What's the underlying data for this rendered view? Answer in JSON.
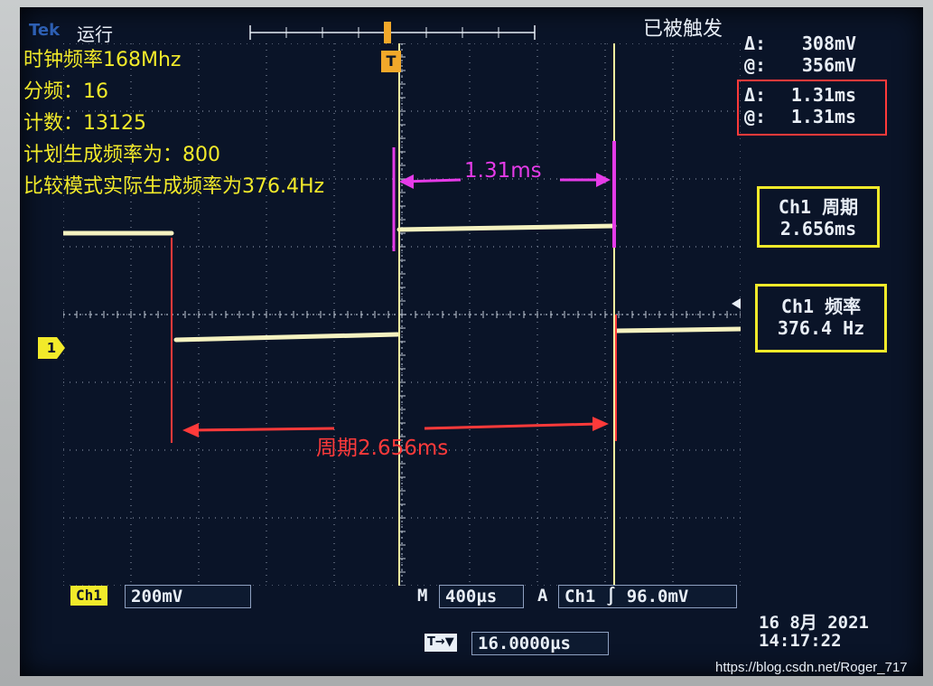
{
  "brand": "Tek",
  "run_state": "运行",
  "trigger_state": "已被触发",
  "overlay_notes": [
    "时钟频率168Mhz",
    "分频：16",
    "计数：13125",
    "计划生成频率为：800",
    "比较模式实际生成频率为376.4Hz"
  ],
  "cursor_amplitude": {
    "delta_label": "Δ:",
    "delta_value": "308mV",
    "at_label": "@:",
    "at_value": "356mV"
  },
  "cursor_time": {
    "delta_label": "Δ:",
    "delta_value": "1.31ms",
    "at_label": "@:",
    "at_value": "1.31ms"
  },
  "measurements": [
    {
      "label": "Ch1 周期",
      "value": "2.656ms"
    },
    {
      "label": "Ch1 频率",
      "value": "376.4 Hz"
    }
  ],
  "annotations": {
    "cursor_span": "1.31ms",
    "period": "周期2.656ms"
  },
  "status_bar": {
    "channel": "Ch1",
    "volts_div": "200mV",
    "timebase_label": "M",
    "timebase": "400µs",
    "trigger_mode": "A",
    "trigger_source": "Ch1",
    "trigger_slope": "∫",
    "trigger_level": "96.0mV",
    "horizontal_position_icon": "T→▼",
    "horizontal_position": "16.0000µs"
  },
  "date": "16 8月  2021",
  "time": "14:17:22",
  "channel_marker": "1",
  "trigger_marker": "T",
  "watermark": "https://blog.csdn.net/Roger_717",
  "colors": {
    "trace": "#f5f2c0",
    "cursor": "#f5f2a0",
    "magenta": "#e53be8",
    "red": "#ff3a3a",
    "highlight_box": "#f2ea2a",
    "screen_bg": "#0a1428"
  }
}
